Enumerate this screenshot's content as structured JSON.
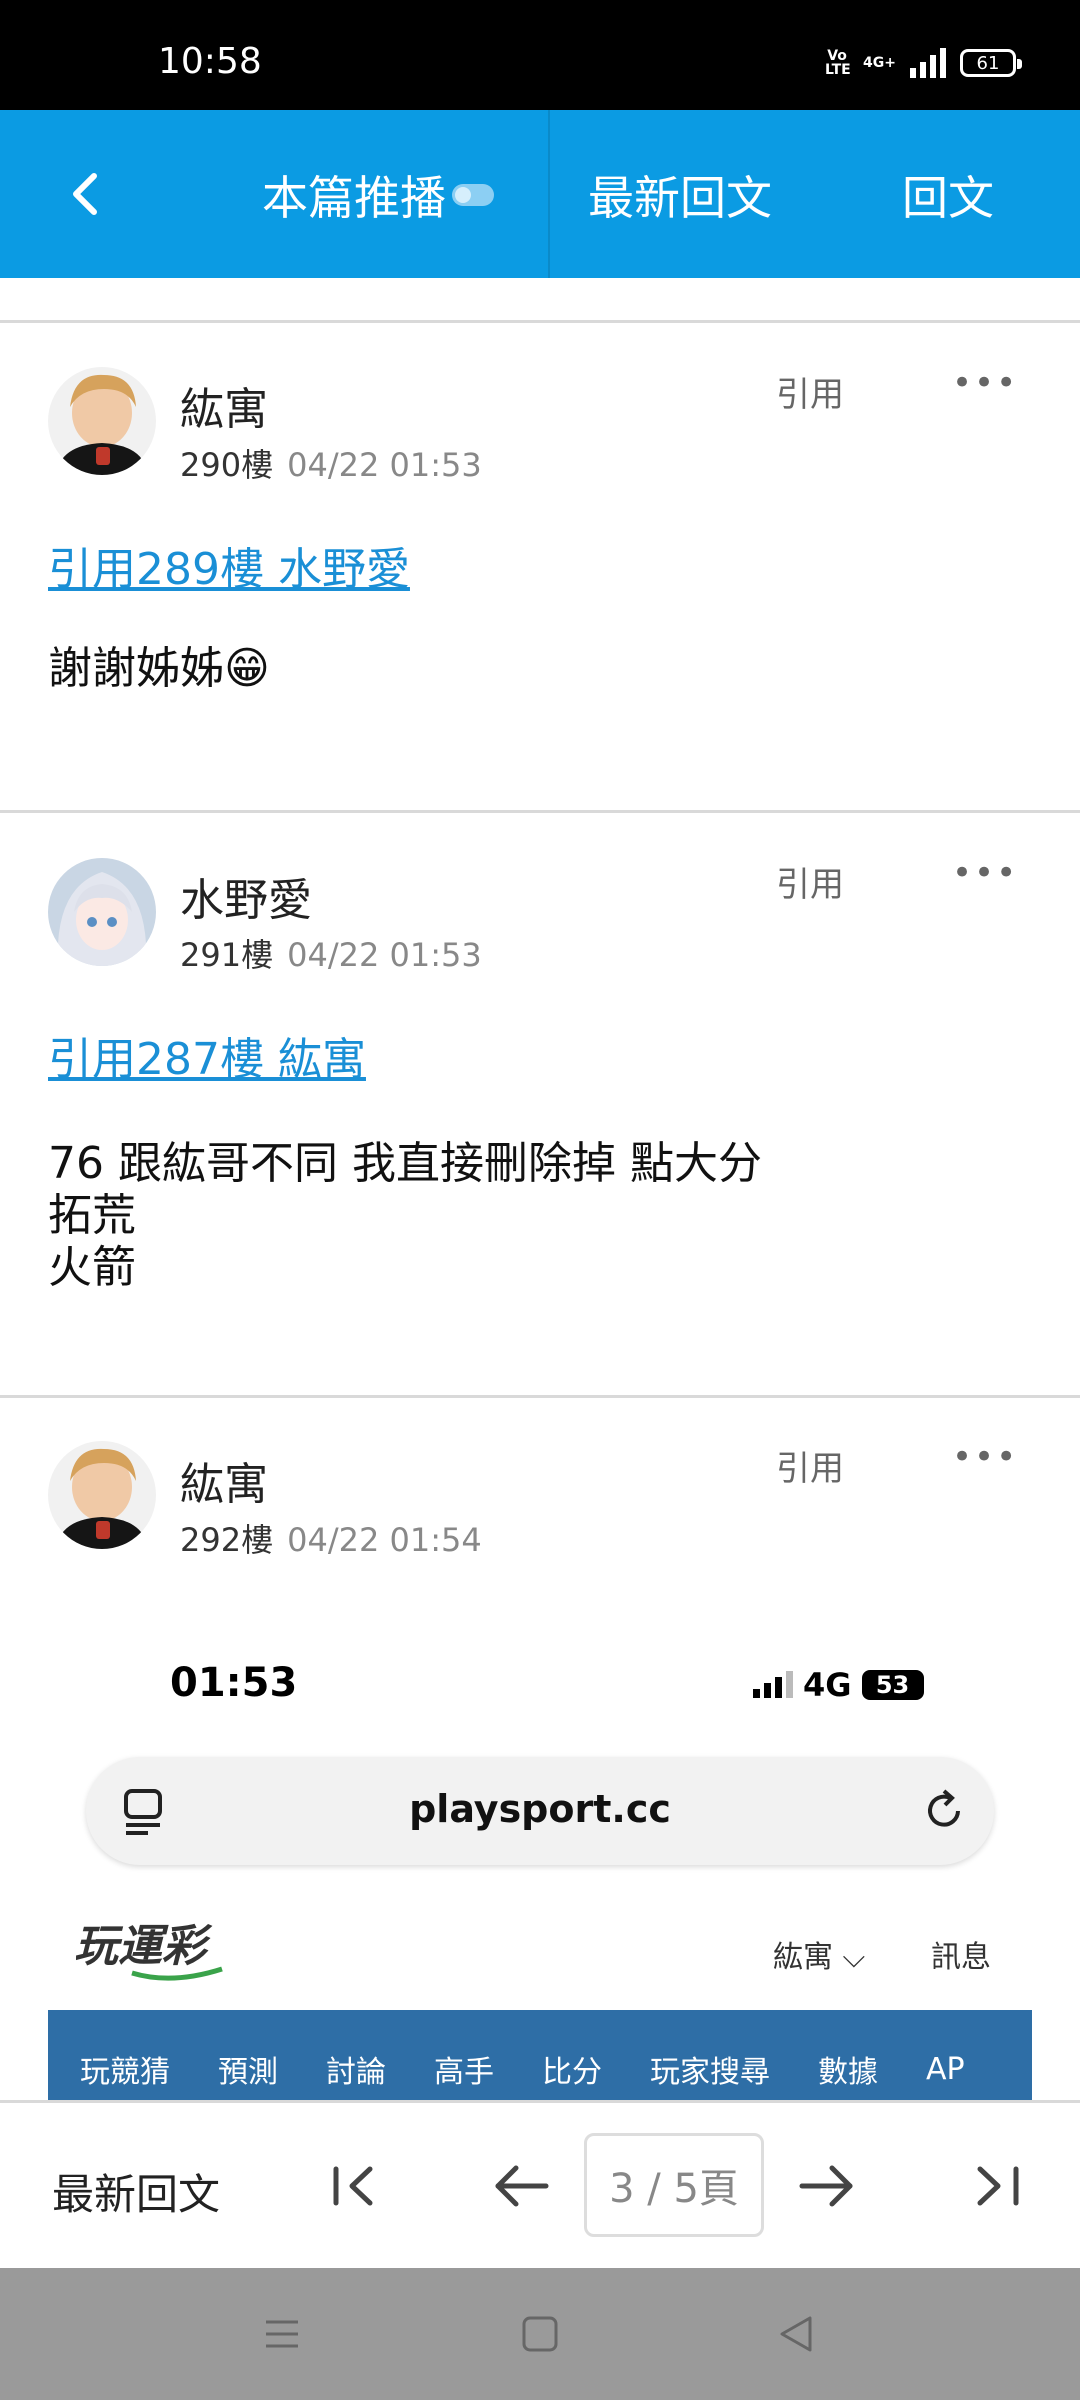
{
  "status_bar": {
    "time": "10:58",
    "volte": "Vo LTE",
    "network": "4G+",
    "battery": "61"
  },
  "header": {
    "back_icon": "back-chevron-icon",
    "broadcast_label": "本篇推播",
    "latest_reply_label": "最新回文",
    "reply_label": "回文",
    "accent_color": "#0b9be3"
  },
  "posts": [
    {
      "author": "紘寓",
      "floor": "290樓",
      "time": "04/22 01:53",
      "quote_label": "引用",
      "more": "•••",
      "quote_link": "引用289樓 水野愛",
      "text": "謝謝姊姊😁"
    },
    {
      "author": "水野愛",
      "floor": "291樓",
      "time": "04/22 01:53",
      "quote_label": "引用",
      "more": "•••",
      "quote_link": "引用287樓 紘寓",
      "lines": [
        "76 跟紘哥不同 我直接刪除掉 點大分",
        "拓荒",
        "火箭"
      ]
    },
    {
      "author": "紘寓",
      "floor": "292樓",
      "time": "04/22 01:54",
      "quote_label": "引用",
      "more": "•••"
    }
  ],
  "embedded_screenshot": {
    "time": "01:53",
    "network": "4G",
    "battery": "53",
    "url": "playsport.cc",
    "site_logo_text": "玩運彩",
    "user": "紘寓",
    "messages": "訊息",
    "nav_items": [
      "玩競猜",
      "預測",
      "討論",
      "高手",
      "比分",
      "玩家搜尋",
      "數據",
      "AP"
    ]
  },
  "pager": {
    "latest_label": "最新回文",
    "page_indicator": "3 / 5頁",
    "first_icon": "first-page-icon",
    "prev_icon": "arrow-left-icon",
    "next_icon": "arrow-right-icon",
    "last_icon": "last-page-icon"
  },
  "android_nav": {
    "menu_icon": "menu-icon",
    "home_icon": "home-icon",
    "back_icon": "back-triangle-icon"
  }
}
